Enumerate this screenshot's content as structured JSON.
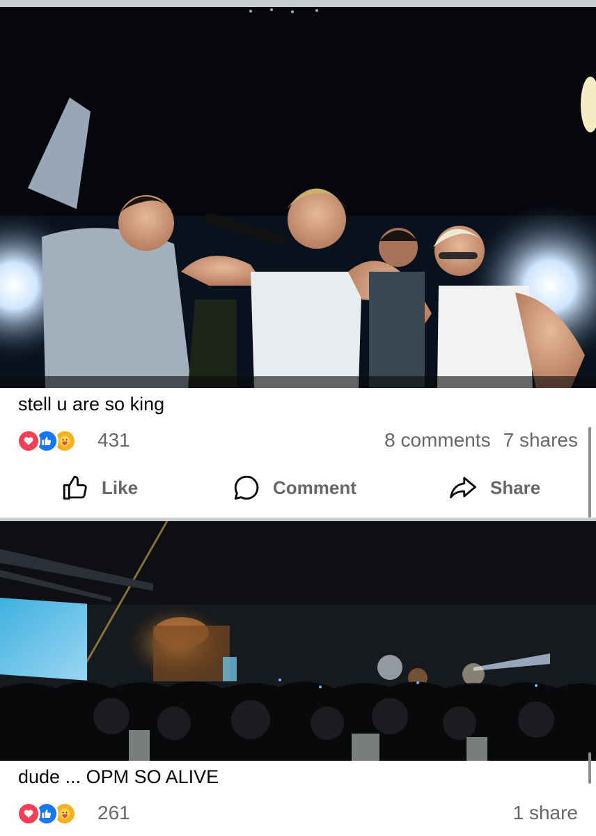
{
  "posts": [
    {
      "caption": "stell u are so king",
      "reaction_count": "431",
      "comments": "8 comments",
      "shares": "7 shares",
      "reaction_icons": [
        "love-icon",
        "like-icon",
        "care-icon"
      ]
    },
    {
      "caption": "dude ... OPM SO ALIVE",
      "reaction_count": "261",
      "shares": "1 share",
      "reaction_icons": [
        "love-icon",
        "like-icon",
        "care-icon"
      ]
    }
  ],
  "actions": {
    "like": "Like",
    "comment": "Comment",
    "share": "Share"
  },
  "colors": {
    "love": "#f33e58",
    "like": "#1877f2",
    "care": "#f7b125",
    "secondary_text": "#65676b",
    "separator": "#c9ccd1"
  }
}
